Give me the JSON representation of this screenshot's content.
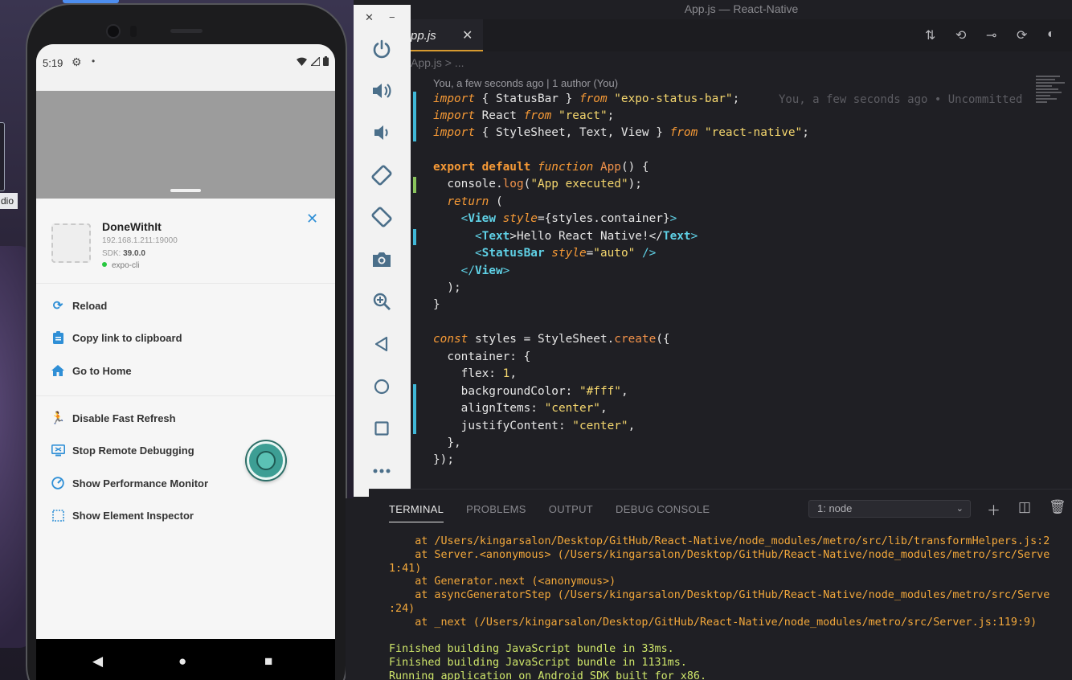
{
  "desktop": {
    "dock_label": "dio"
  },
  "phone": {
    "status": {
      "time": "5:19",
      "dot": "•"
    },
    "app": {
      "name": "DoneWithIt",
      "host": "192.168.1.211:19000",
      "sdk_label": "SDK:",
      "sdk_version": "39.0.0",
      "cli": "expo-cli"
    },
    "menu": [
      {
        "label": "Reload",
        "icon": "reload-icon"
      },
      {
        "label": "Copy link to clipboard",
        "icon": "clipboard-icon"
      },
      {
        "label": "Go to Home",
        "icon": "home-icon"
      },
      {
        "label": "Disable Fast Refresh",
        "icon": "run-icon"
      },
      {
        "label": "Stop Remote Debugging",
        "icon": "monitor-debug-icon"
      },
      {
        "label": "Show Performance Monitor",
        "icon": "speedometer-icon"
      },
      {
        "label": "Show Element Inspector",
        "icon": "select-box-icon"
      }
    ]
  },
  "emulator_toolbar": {
    "close": "✕",
    "minimize": "−",
    "buttons": [
      "power-icon",
      "volume-up-icon",
      "volume-down-icon",
      "rotate-left-icon",
      "rotate-right-icon",
      "camera-icon",
      "zoom-icon",
      "back-icon",
      "home-icon",
      "overview-icon",
      "more-icon"
    ]
  },
  "vscode": {
    "window_title": "App.js — React-Native",
    "tab_label": "pp.js",
    "breadcrumb": "App.js > ...",
    "blame": "You, a few seconds ago | 1 author (You)",
    "inline_blame": "You, a few seconds ago • Uncommitted"
  },
  "terminal": {
    "tabs": [
      "TERMINAL",
      "PROBLEMS",
      "OUTPUT",
      "DEBUG CONSOLE"
    ],
    "selected_terminal": "1: node",
    "lines": [
      {
        "text": "    at /Users/kingarsalon/Desktop/GitHub/React-Native/node_modules/metro/src/lib/transformHelpers.js:2",
        "kind": "orange"
      },
      {
        "text": "    at Server.<anonymous> (/Users/kingarsalon/Desktop/GitHub/React-Native/node_modules/metro/src/Serve",
        "kind": "orange"
      },
      {
        "text": "1:41)",
        "kind": "orange"
      },
      {
        "text": "    at Generator.next (<anonymous>)",
        "kind": "orange"
      },
      {
        "text": "    at asyncGeneratorStep (/Users/kingarsalon/Desktop/GitHub/React-Native/node_modules/metro/src/Serve",
        "kind": "orange"
      },
      {
        "text": ":24)",
        "kind": "orange"
      },
      {
        "text": "    at _next (/Users/kingarsalon/Desktop/GitHub/React-Native/node_modules/metro/src/Server.js:119:9)",
        "kind": "orange"
      },
      {
        "text": "",
        "kind": "orange"
      },
      {
        "text": "Finished building JavaScript bundle in 33ms.",
        "kind": "green"
      },
      {
        "text": "Finished building JavaScript bundle in 1131ms.",
        "kind": "green"
      },
      {
        "text": "Running application on Android SDK built for x86.",
        "kind": "green"
      }
    ]
  },
  "code": {
    "l1": {
      "imp": "import",
      "a": " { StatusBar } ",
      "from": "from",
      "s": " \"expo-status-bar\"",
      "end": ";"
    },
    "l2": {
      "imp": "import",
      "a": " React ",
      "from": "from",
      "s": " \"react\"",
      "end": ";"
    },
    "l3": {
      "imp": "import",
      "a": " { StyleSheet, Text, View } ",
      "from": "from",
      "s": " \"react-native\"",
      "end": ";"
    },
    "l5": {
      "exp": "export default",
      "func": " function",
      "name": " App",
      "rest": "() {"
    },
    "l6": {
      "a": "  console.",
      "fn": "log",
      "b": "(",
      "s": "\"App executed\"",
      "c": ");"
    },
    "l7": {
      "ret": "  return",
      "rest": " ("
    },
    "l8": {
      "open": "    <",
      "tag": "View",
      "attr": " style",
      "rest": "={styles.container}",
      "close": ">"
    },
    "l9": {
      "open": "      <",
      "tag": "Text",
      "mid": ">Hello React Native!</",
      "tag2": "Text",
      "close": ">"
    },
    "l10": {
      "open": "      <",
      "tag": "StatusBar",
      "attr": " style",
      "eq": "=",
      "s": "\"auto\"",
      "close": " />"
    },
    "l11": {
      "open": "    </",
      "tag": "View",
      "close": ">"
    },
    "l12": {
      "t": "  );"
    },
    "l13": {
      "t": "}"
    },
    "l15": {
      "kw": "const",
      "a": " styles = StyleSheet.",
      "fn": "create",
      "b": "({"
    },
    "l16": {
      "t": "  container: {"
    },
    "l17": {
      "a": "    flex: ",
      "n": "1",
      "b": ","
    },
    "l18": {
      "a": "    backgroundColor: ",
      "s": "\"#fff\"",
      "b": ","
    },
    "l19": {
      "a": "    alignItems: ",
      "s": "\"center\"",
      "b": ","
    },
    "l20": {
      "a": "    justifyContent: ",
      "s": "\"center\"",
      "b": ","
    },
    "l21": {
      "t": "  },"
    },
    "l22": {
      "t": "});"
    }
  }
}
